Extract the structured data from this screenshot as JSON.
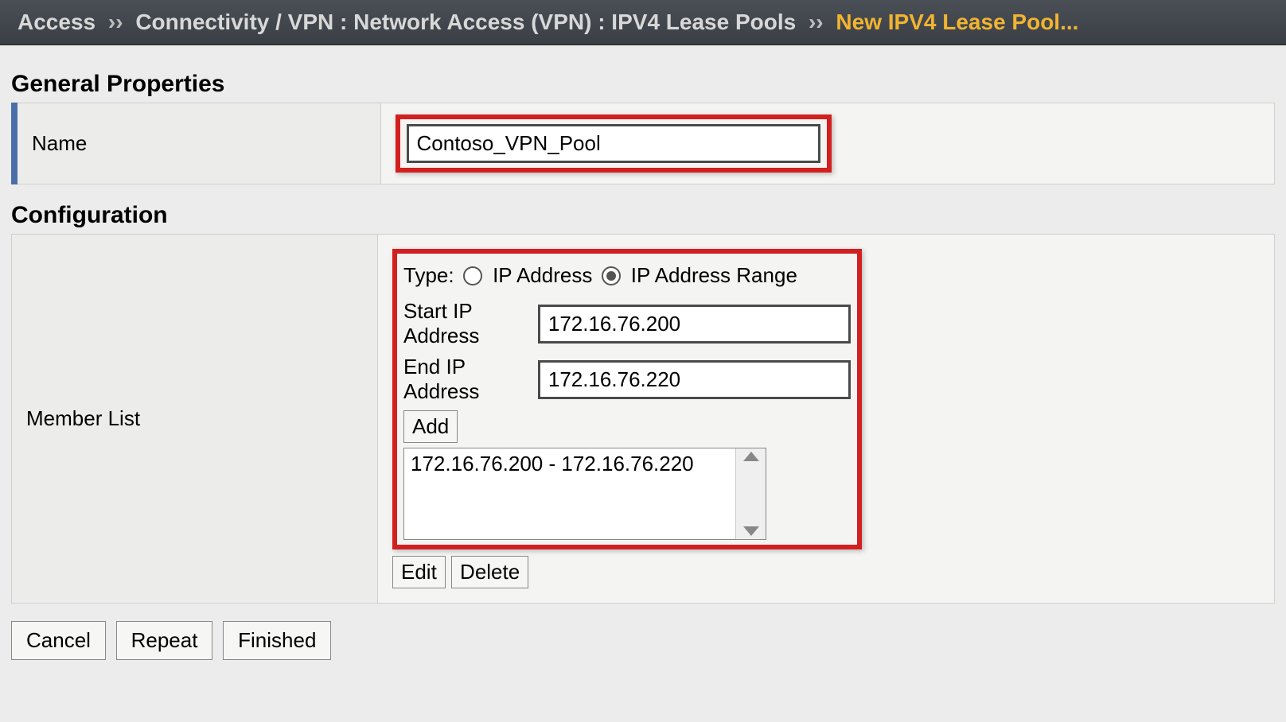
{
  "breadcrumb": {
    "item1": "Access",
    "sep": "››",
    "item2": "Connectivity / VPN : Network Access (VPN) : IPV4 Lease Pools",
    "current": "New IPV4 Lease Pool..."
  },
  "sections": {
    "general_properties": "General Properties",
    "configuration": "Configuration"
  },
  "general": {
    "name_label": "Name",
    "name_value": "Contoso_VPN_Pool"
  },
  "config": {
    "member_list_label": "Member List",
    "type_label": "Type:",
    "type_option1": "IP Address",
    "type_option2": "IP Address Range",
    "start_ip_label": "Start IP Address",
    "start_ip_value": "172.16.76.200",
    "end_ip_label": "End IP Address",
    "end_ip_value": "172.16.76.220",
    "add_btn": "Add",
    "member_list_items": [
      "172.16.76.200 - 172.16.76.220"
    ],
    "edit_btn": "Edit",
    "delete_btn": "Delete"
  },
  "footer": {
    "cancel": "Cancel",
    "repeat": "Repeat",
    "finished": "Finished"
  }
}
